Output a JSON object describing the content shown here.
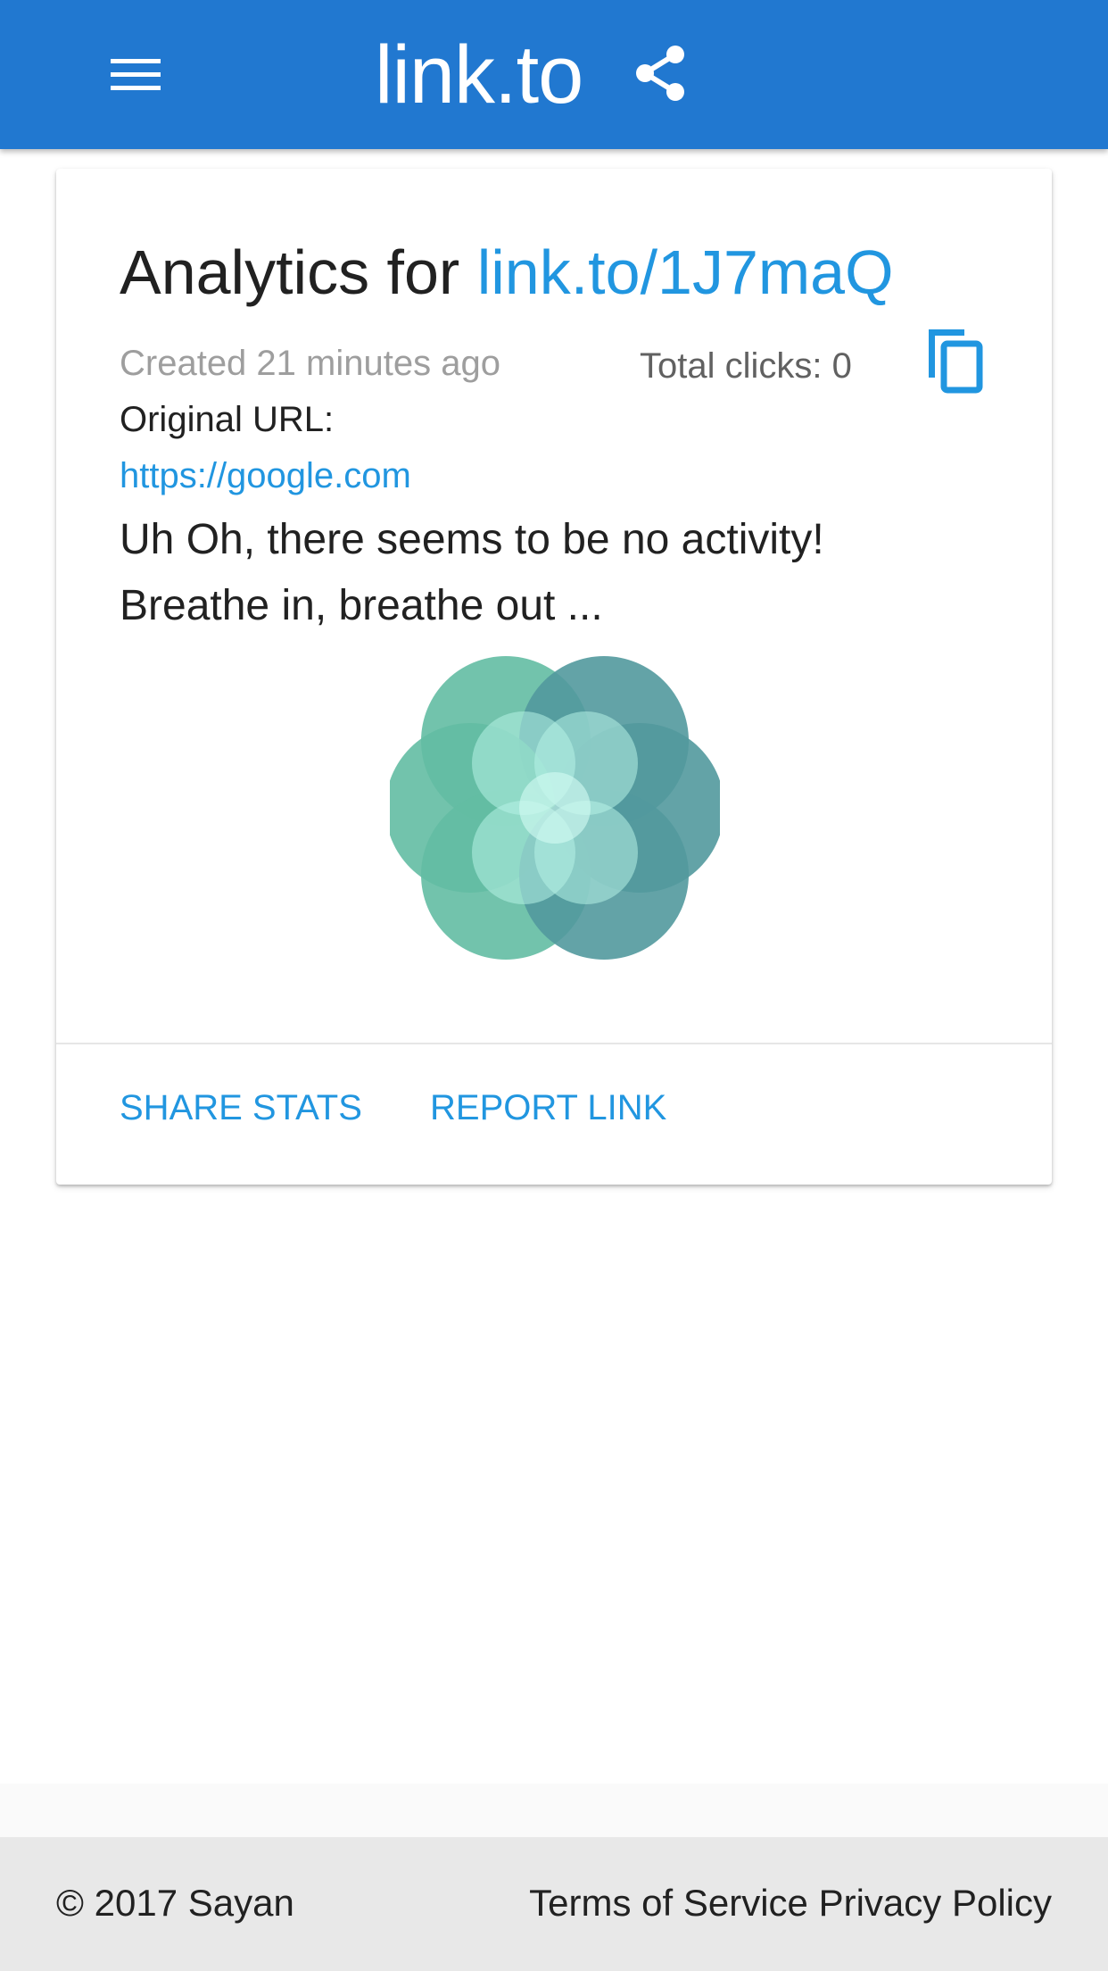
{
  "app_bar": {
    "title": "link.to",
    "menu_icon": "menu-icon",
    "share_icon": "share-icon",
    "background": "#2178d0"
  },
  "card": {
    "title_prefix": "Analytics for",
    "short_link": "link.to/1J7maQ",
    "created_text": "Created 21 minutes ago",
    "total_clicks_text": "Total clicks: 0",
    "copy_icon": "copy-icon",
    "original_url_label": "Original URL:",
    "original_url": "https://google.com",
    "empty_message": "Uh Oh, there seems to be no activity!",
    "empty_submessage": "Breathe in, breathe out ...",
    "illustration": "breathing-flower-illustration",
    "actions": {
      "share_stats": "SHARE STATS",
      "report_link": "REPORT LINK"
    },
    "accent": "#2196e0"
  },
  "footer": {
    "copyright": "© 2017 Sayan",
    "terms": "Terms of Service",
    "privacy": "Privacy Policy"
  }
}
